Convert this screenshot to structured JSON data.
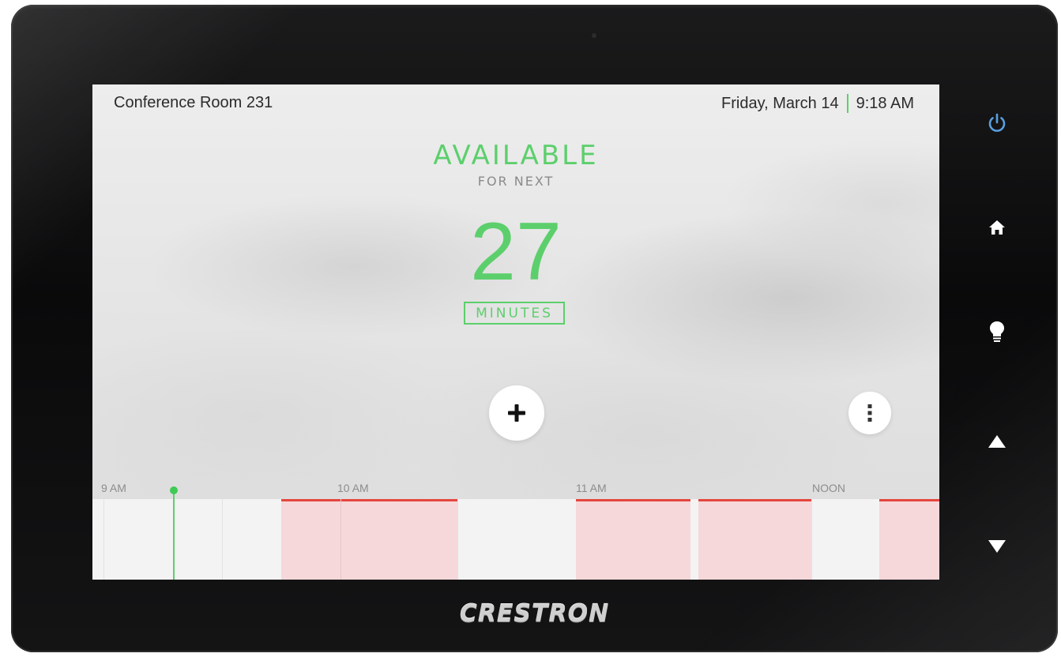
{
  "header": {
    "room_name": "Conference Room 231",
    "date": "Friday, March 14",
    "time": "9:18 AM"
  },
  "status": {
    "label": "AVAILABLE",
    "sublabel": "FOR NEXT",
    "count": "27",
    "unit": "MINUTES"
  },
  "actions": {
    "add_icon": "plus-icon",
    "more_icon": "vertical-ellipsis-icon"
  },
  "timeline": {
    "hours": [
      "9 AM",
      "10 AM",
      "11 AM",
      "NOON"
    ],
    "colors": {
      "available": "#5ccf6c",
      "booked_fill": "#f6d8da",
      "booked_border": "#e5463f"
    }
  },
  "hardware_buttons": [
    "power-icon",
    "home-icon",
    "lightbulb-icon",
    "up-arrow-icon",
    "down-arrow-icon"
  ],
  "brand": "CRESTRON"
}
